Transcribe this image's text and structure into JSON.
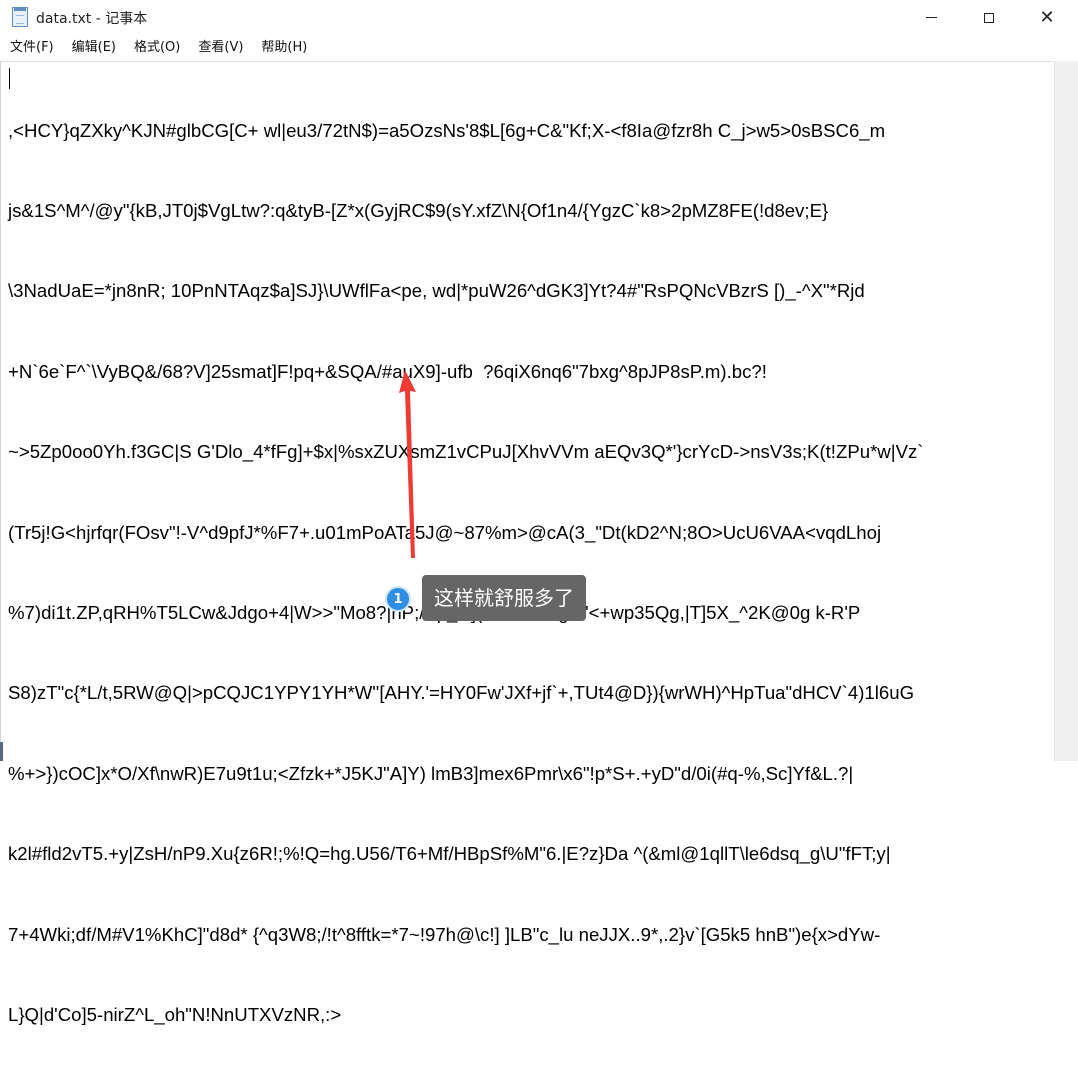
{
  "window": {
    "title": "data.txt - 记事本",
    "icons": {
      "app": "notepad-icon",
      "minimize": "minimize-icon",
      "maximize": "maximize-icon",
      "close": "close-icon"
    },
    "close_glyph": "✕"
  },
  "menu": [
    {
      "label": "文件(F)"
    },
    {
      "label": "编辑(E)"
    },
    {
      "label": "格式(O)"
    },
    {
      "label": "查看(V)"
    },
    {
      "label": "帮助(H)"
    }
  ],
  "editor": {
    "lines": [
      ",<HCY}qZXky^KJN#glbCG[C+ wl|eu3/72tN$)=a5OzsNs'8$L[6g+C&\"Kf;X-<f8Ia@fzr8h C_j>w5>0sBSC6_m",
      "js&1S^M^/@y\"{kB,JT0j$VgLtw?:q&tyB-[Z*x(GyjRC$9(sY.xfZ\\N{Of1n4/{YgzC`k8>2pMZ8FE(!d8ev;E}",
      "\\3NadUaE=*jn8nR; 10PnNTAqz$a]SJ}\\UWflFa<pe, wd|*puW26^dGK3]Yt?4#\"RsPQNcVBzrS [)_-^X\"*Rjd",
      "+N`6e`F^`\\VyBQ&/68?V]25smat]F!pq+&SQA/#auX9]-ufb  ?6qiX6nq6\"7bxg^8pJP8sP.m).bc?!",
      "~>5Zp0oo0Yh.f3GC|S G'Dlo_4*fFg]+$x|%sxZUXsmZ1vCPuJ[XhvVVm aEQv3Q*'}crYcD->nsV3s;K(t!ZPu*w|Vz`",
      "(Tr5j!G<hjrfqr(FOsv\"!-V^d9pfJ*%F7+.u01mPoATa5J@~87%m>@cA(3_\"Dt(kD2^N;8O>UcU6VAA<vqdLhoj",
      "%7)di1t.ZP,qRH%T5LCw&Jdgo+4|W>>\"Mo8?|hP;/Sp_w]($S>I=b/<gr6'<+wp35Qg,|T]5X_^2K@0g k-R'P",
      "S8)zT\"c{*L/t,5RW@Q|>pCQJC1YPY1YH*W''[AHY.'=HY0Fw'JXf+jf`+,TUt4@D}){wrWH)^HpTua\"dHCV`4)1l6uG",
      "%+>})cOC]x*O/Xf\\nwR)E7u9t1u;<Zfzk+*J5KJ\"A]Y) lmB3]mex6Pmr\\x6\"!p*S+.+yD\"d/0i(#q-%,Sc]Yf&L.?|",
      "k2l#fld2vT5.+y|ZsH/nP9.Xu{z6R!;%!Q=hg.U56/T6+Mf/HBpSf%M\"6.|E?z}Da ^(&ml@1qllT\\le6dsq_g\\U\"fFT;y|",
      "7+4Wki;df/M#V1%KhC]\"d8d* {^q3W8;/!t^8fftk=*7~!97h@\\c!] ]LB\"c_lu neJJX..9*,.2}v`[G5k5 hnB\")e{x>dYw-",
      "L}Q|d'Co]5-nirZ^L_oh\"N!NnUTXVzNR,:>"
    ]
  },
  "annotation": {
    "number": "1",
    "text": "这样就舒服多了",
    "arrow_color": "#ee3b34",
    "badge_color": "#2f8de4",
    "box_color": "#666666"
  }
}
